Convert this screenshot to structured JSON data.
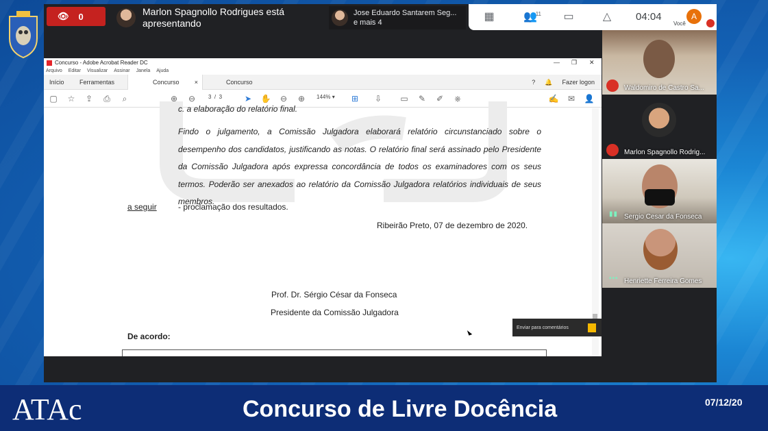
{
  "meet": {
    "viewer_count": "0",
    "presenter_text": "Marlon Spagnollo Rodrigues está apresentando",
    "others_name": "Jose Eduardo Santarem Seg...",
    "others_more": "e mais 4",
    "people_count": "11",
    "clock": "04:04",
    "me_initial": "A",
    "me_label": "Você"
  },
  "acrobat": {
    "window_title": "Concurso - Adobe Acrobat Reader DC",
    "menu": [
      "Arquivo",
      "Editar",
      "Visualizar",
      "Assinar",
      "Janela",
      "Ajuda"
    ],
    "tabs": [
      "Início",
      "Ferramentas",
      "Concurso",
      "Concurso"
    ],
    "tab_close": "×",
    "sign_in": "Fazer logon",
    "page_current": "3",
    "page_sep": "/",
    "page_total": "3",
    "zoom": "144%",
    "send_comments": "Enviar para comentários"
  },
  "document": {
    "cut_top_line": "c. a elaboração do relatório final.",
    "paragraph": "Findo o julgamento, a Comissão Julgadora elaborará relatório circunstanciado sobre o desempenho dos candidatos, justificando as notas. O relatório final será assinado pelo Presidente da Comissão Julgadora após expressa concordância de todos os examinadores com os seus termos. Poderão ser anexados ao relatório da Comissão Julgadora relatórios individuais de seus membros.",
    "a_seguir": "a seguir",
    "proclamation": "- proclamação dos resultados.",
    "place_date": "Ribeirão Preto, 07 de dezembro de 2020.",
    "signer_name": "Prof. Dr. Sérgio César da Fonseca",
    "signer_role": "Presidente da Comissão Julgadora",
    "agreement": "De acordo:"
  },
  "participants": [
    {
      "name": "Waldomiro de Castro Sa...",
      "muted": true
    },
    {
      "name": "Marlon Spagnollo Rodrig...",
      "muted": true
    },
    {
      "name": "Sergio Cesar da Fonseca",
      "muted": false
    },
    {
      "name": "Henriette Ferreira Gomes",
      "muted": false
    }
  ],
  "banner": {
    "logo_text": "ATAc",
    "title": "Concurso de Livre Docência",
    "date": "07/12/20"
  },
  "colors": {
    "banner_bg": "#0d2d76",
    "meet_red": "#d93025",
    "acrobat_blue": "#2d7ad6"
  }
}
